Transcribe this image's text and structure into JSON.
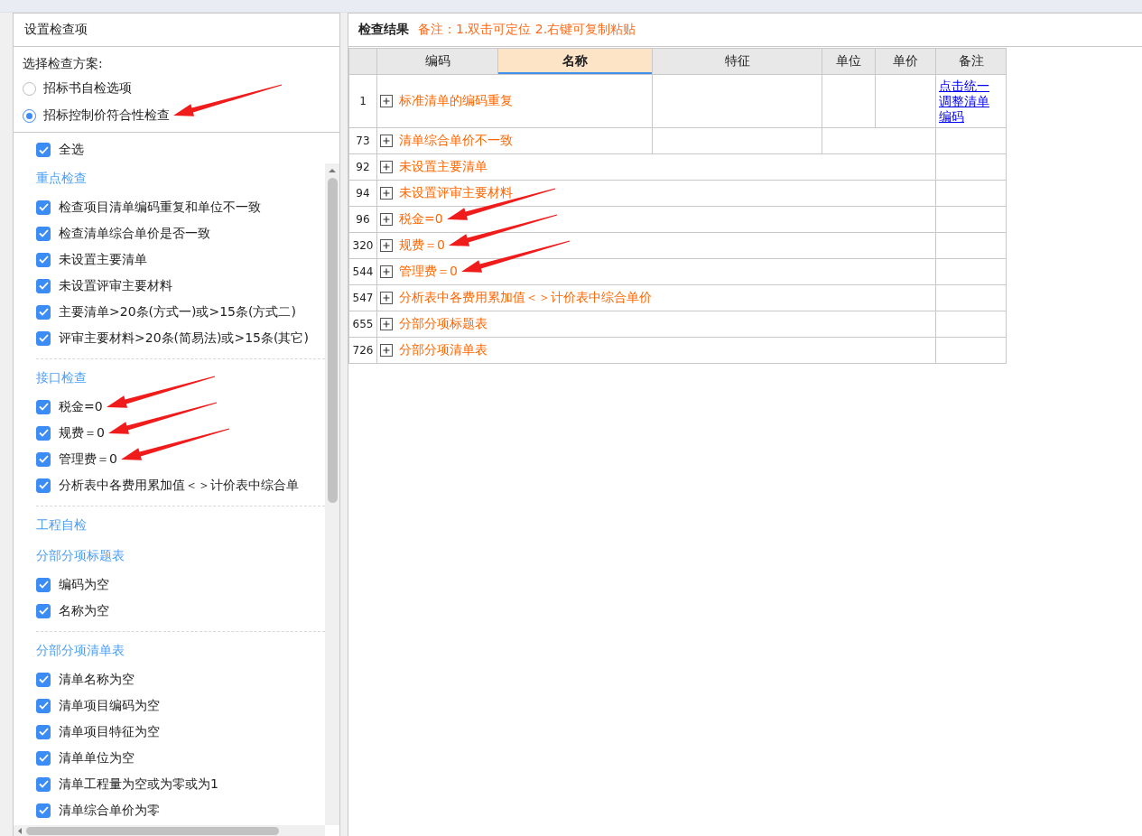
{
  "left_panel": {
    "title": "设置检查项",
    "scheme": {
      "label": "选择检查方案:",
      "options": [
        {
          "label": "招标书自检选项",
          "selected": false,
          "annotated": false
        },
        {
          "label": "招标控制价符合性检查",
          "selected": true,
          "annotated": true
        }
      ]
    },
    "select_all": {
      "label": "全选",
      "checked": true
    },
    "groups": [
      {
        "title": "重点检查",
        "items": [
          {
            "label": "检查项目清单编码重复和单位不一致",
            "checked": true,
            "annotated": false
          },
          {
            "label": "检查清单综合单价是否一致",
            "checked": true,
            "annotated": false
          },
          {
            "label": "未设置主要清单",
            "checked": true,
            "annotated": false
          },
          {
            "label": "未设置评审主要材料",
            "checked": true,
            "annotated": false
          },
          {
            "label": "主要清单>20条(方式一)或>15条(方式二)",
            "checked": true,
            "annotated": false
          },
          {
            "label": "评审主要材料>20条(简易法)或>15条(其它)",
            "checked": true,
            "annotated": false
          }
        ]
      },
      {
        "title": "接口检查",
        "items": [
          {
            "label": "税金=0",
            "checked": true,
            "annotated": true
          },
          {
            "label": "规费＝0",
            "checked": true,
            "annotated": true
          },
          {
            "label": "管理费＝0",
            "checked": true,
            "annotated": true
          },
          {
            "label": "分析表中各费用累加值＜＞计价表中综合单",
            "checked": true,
            "annotated": false
          }
        ]
      },
      {
        "title": "工程自检"
      },
      {
        "title": "分部分项标题表",
        "items": [
          {
            "label": "编码为空",
            "checked": true,
            "annotated": false
          },
          {
            "label": "名称为空",
            "checked": true,
            "annotated": false
          }
        ]
      },
      {
        "title": "分部分项清单表",
        "items": [
          {
            "label": "清单名称为空",
            "checked": true,
            "annotated": false
          },
          {
            "label": "清单项目编码为空",
            "checked": true,
            "annotated": false
          },
          {
            "label": "清单项目特征为空",
            "checked": true,
            "annotated": false
          },
          {
            "label": "清单单位为空",
            "checked": true,
            "annotated": false
          },
          {
            "label": "清单工程量为空或为零或为1",
            "checked": true,
            "annotated": false
          },
          {
            "label": "清单综合单价为零",
            "checked": true,
            "annotated": false
          }
        ]
      }
    ]
  },
  "right_panel": {
    "title": "检查结果",
    "note": "备注：1.双击可定位 2.右键可复制粘贴",
    "table": {
      "columns": [
        {
          "label": "编码",
          "selected": false
        },
        {
          "label": "名称",
          "selected": true
        },
        {
          "label": "特征",
          "selected": false
        },
        {
          "label": "单位",
          "selected": false
        },
        {
          "label": "单价",
          "selected": false
        },
        {
          "label": "备注",
          "selected": false
        }
      ],
      "rows": [
        {
          "kind": "split",
          "number": "1",
          "name": "标准清单的编码重复",
          "expanded": false,
          "annotated": false,
          "remark_link": "点击统一调整清单编码"
        },
        {
          "kind": "merged",
          "number": "73",
          "name": "清单综合单价不一致",
          "expanded": false,
          "annotated": false
        },
        {
          "kind": "wide",
          "number": "92",
          "name": "未设置主要清单",
          "expanded": false,
          "annotated": false
        },
        {
          "kind": "wide",
          "number": "94",
          "name": "未设置评审主要材料",
          "expanded": false,
          "annotated": false
        },
        {
          "kind": "wide",
          "number": "96",
          "name": "税金=0",
          "expanded": false,
          "annotated": true
        },
        {
          "kind": "wide",
          "number": "320",
          "name": "规费＝0",
          "expanded": false,
          "annotated": true
        },
        {
          "kind": "wide",
          "number": "544",
          "name": "管理费＝0",
          "expanded": false,
          "annotated": true
        },
        {
          "kind": "wide",
          "number": "547",
          "name": "分析表中各费用累加值＜＞计价表中综合单价",
          "expanded": false,
          "annotated": false
        },
        {
          "kind": "wide",
          "number": "655",
          "name": "分部分项标题表",
          "expanded": false,
          "annotated": false
        },
        {
          "kind": "wide",
          "number": "726",
          "name": "分部分项清单表",
          "expanded": false,
          "annotated": false
        }
      ]
    }
  }
}
